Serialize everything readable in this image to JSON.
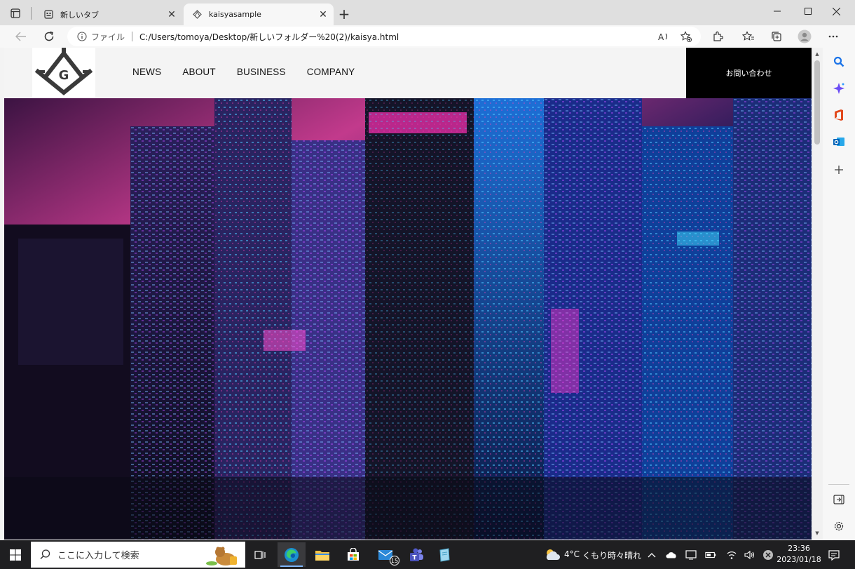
{
  "browser": {
    "tabs": [
      {
        "label": "新しいタブ",
        "active": false,
        "icon": "new-tab-page-icon"
      },
      {
        "label": "kaisyasample",
        "active": true,
        "icon": "logo-favicon-icon"
      }
    ],
    "omnibox": {
      "scheme_label": "ファイル",
      "url": "C:/Users/tomoya/Desktop/新しいフォルダー%20(2)/kaisya.html"
    },
    "window_controls": [
      "minimize-icon",
      "maximize-icon",
      "close-icon"
    ],
    "sidebar_icons": [
      "search-icon",
      "copilot-icon",
      "office-icon",
      "outlook-icon",
      "add-icon"
    ],
    "sidebar_bottom_icons": [
      "hide-sidebar-icon",
      "settings-icon"
    ]
  },
  "site": {
    "nav": [
      "NEWS",
      "ABOUT",
      "BUSINESS",
      "COMPANY"
    ],
    "contact_button": "お問い合わせ",
    "logo_letter": "G",
    "hero_alt": "neon-city"
  },
  "taskbar": {
    "search_placeholder": "ここに入力して検索",
    "mail_badge": "15",
    "weather_temp": "4°C",
    "weather_text": "くもり時々晴れ",
    "time": "23:36",
    "date": "2023/01/18"
  },
  "colors": {
    "contact_bg": "#000000",
    "header_bg": "#f4f4f4",
    "taskbar_bg": "#1f1f21",
    "neon_pink": "#ff2fb5",
    "neon_blue": "#3aa0ff",
    "neon_purple": "#7a3cff"
  }
}
